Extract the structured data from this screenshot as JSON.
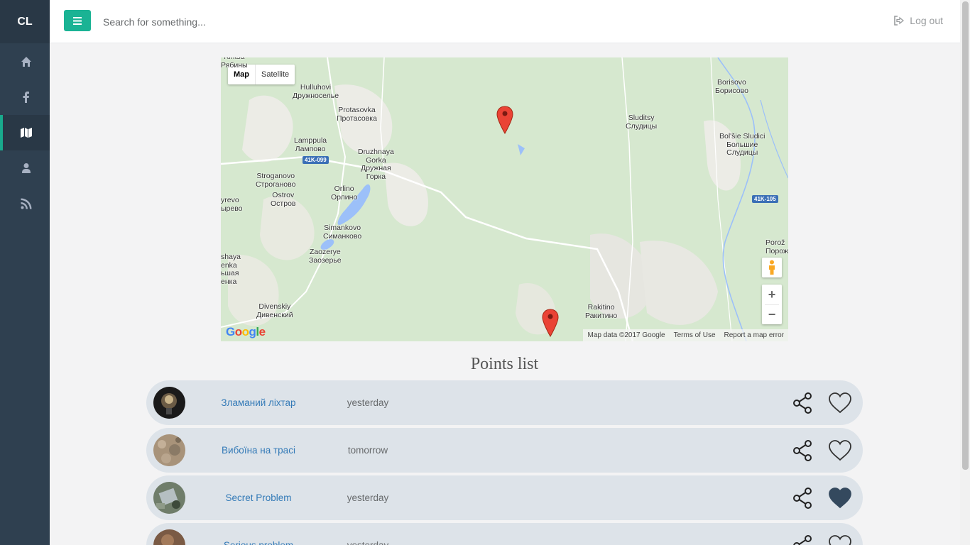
{
  "sidebar": {
    "brand": "CL",
    "items": [
      {
        "name": "home",
        "icon": "home-icon"
      },
      {
        "name": "facebook",
        "icon": "facebook-icon"
      },
      {
        "name": "map",
        "icon": "map-icon",
        "active": true
      },
      {
        "name": "user",
        "icon": "user-icon"
      },
      {
        "name": "rss",
        "icon": "rss-icon"
      }
    ]
  },
  "topbar": {
    "menu_icon": "bars-icon",
    "search_placeholder": "Search for something...",
    "logout_label": "Log out",
    "logout_icon": "sign-out-icon"
  },
  "map": {
    "type_map": "Map",
    "type_satellite": "Satellite",
    "attribution": "Map data ©2017 Google",
    "terms": "Terms of Use",
    "report": "Report a map error",
    "logo_text": "Google",
    "place_labels": [
      "Kiritsa\nРябины",
      "Hulluhovi\nДружноселье",
      "Protasovka\nПротасовка",
      "Lamppula\nЛампово",
      "Druzhnaya\nGorka\nДружная\nГорка",
      "Stroganovo\nСтроганово",
      "Orlino\nОрлино",
      "Ostrov\nОстров",
      "yrevo\nырево",
      "Simankovo\nСиманково",
      "Zaozerye\nЗаозерье",
      "shaya\nenka\nьшая\nенка",
      "Divenskiy\nДивенский",
      "Sluditsy\nСлудицы",
      "Borisovo\nБорисово",
      "Bol'šie Sludici\nБольшие\nСлудицы",
      "Porož\nПорож",
      "Rakitino\nРакитино"
    ],
    "road_badges": [
      "41K-099",
      "41K-105"
    ],
    "zoom_in": "+",
    "zoom_out": "−"
  },
  "points": {
    "title": "Points list",
    "items": [
      {
        "name": "Зламаний ліхтар",
        "time": "yesterday",
        "liked": false
      },
      {
        "name": "Вибоїна на трасі",
        "time": "tomorrow",
        "liked": false
      },
      {
        "name": "Secret Problem",
        "time": "yesterday",
        "liked": true
      },
      {
        "name": "Serious problem",
        "time": "yesterday",
        "liked": false
      }
    ]
  }
}
